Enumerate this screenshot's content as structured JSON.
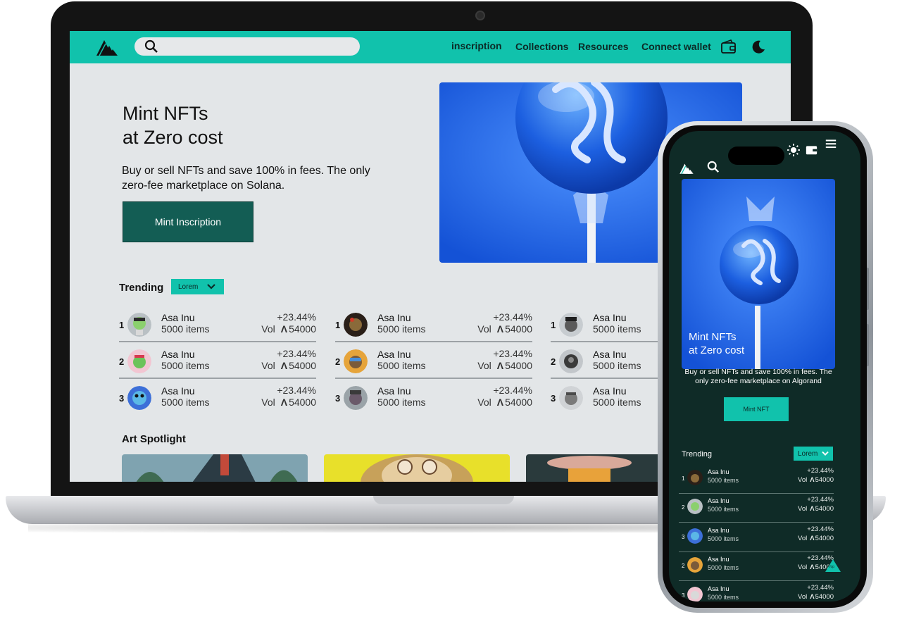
{
  "desktop": {
    "nav": {
      "links": [
        "inscription",
        "Collections",
        "Resources",
        "Connect wallet"
      ],
      "icons": [
        "wallet-icon",
        "moon-icon"
      ]
    },
    "hero": {
      "title_line1": "Mint NFTs",
      "title_line2": "at Zero cost",
      "subtitle": "Buy or sell NFTs and save 100% in fees. The only zero-fee marketplace on Solana.",
      "button_label": "Mint Inscription"
    },
    "trending": {
      "heading": "Trending",
      "dropdown_value": "Lorem",
      "columns": [
        [
          {
            "rank": "1",
            "name": "Asa Inu",
            "items": "5000 items",
            "change": "+23.44%",
            "vol_label": "Vol",
            "volume": "54000"
          },
          {
            "rank": "2",
            "name": "Asa Inu",
            "items": "5000 items",
            "change": "+23.44%",
            "vol_label": "Vol",
            "volume": "54000"
          },
          {
            "rank": "3",
            "name": "Asa Inu",
            "items": "5000 items",
            "change": "+23.44%",
            "vol_label": "Vol",
            "volume": "54000"
          }
        ],
        [
          {
            "rank": "1",
            "name": "Asa Inu",
            "items": "5000 items",
            "change": "+23.44%",
            "vol_label": "Vol",
            "volume": "54000"
          },
          {
            "rank": "2",
            "name": "Asa Inu",
            "items": "5000 items",
            "change": "+23.44%",
            "vol_label": "Vol",
            "volume": "54000"
          },
          {
            "rank": "3",
            "name": "Asa Inu",
            "items": "5000 items",
            "change": "+23.44%",
            "vol_label": "Vol",
            "volume": "54000"
          }
        ],
        [
          {
            "rank": "1",
            "name": "Asa Inu",
            "items": "5000 items"
          },
          {
            "rank": "2",
            "name": "Asa Inu",
            "items": "5000 items"
          },
          {
            "rank": "3",
            "name": "Asa Inu",
            "items": "5000 items"
          }
        ]
      ]
    },
    "art_spotlight": {
      "heading": "Art Spotlight"
    }
  },
  "mobile": {
    "icons": [
      "logo",
      "search-icon",
      "sun-icon",
      "wallet-icon",
      "menu-icon"
    ],
    "hero": {
      "title_line1": "Mint NFTs",
      "title_line2": "at Zero cost",
      "subtitle": "Buy or sell NFTs and save 100% in fees. The only zero-fee marketplace on Algorand",
      "button_label": "Mint  NFT"
    },
    "trending": {
      "heading": "Trending",
      "dropdown_value": "Lorem",
      "rows": [
        {
          "rank": "1",
          "name": "Asa Inu",
          "items": "5000 items",
          "change": "+23.44%",
          "vol_label": "Vol",
          "volume": "54000"
        },
        {
          "rank": "2",
          "name": "Asa Inu",
          "items": "5000 items",
          "change": "+23.44%",
          "vol_label": "Vol",
          "volume": "54000"
        },
        {
          "rank": "3",
          "name": "Asa Inu",
          "items": "5000 items",
          "change": "+23.44%",
          "vol_label": "Vol",
          "volume": "54000"
        },
        {
          "rank": "2",
          "name": "Asa Inu",
          "items": "5000 items",
          "change": "+23.44%",
          "vol_label": "Vol",
          "volume": "54000"
        },
        {
          "rank": "3",
          "name": "Asa Inu",
          "items": "5000 items",
          "change": "+23.44%",
          "vol_label": "Vol",
          "volume": "54000"
        }
      ]
    },
    "scroll_top_label": "Top"
  },
  "colors": {
    "accent": "#11c2ac",
    "dark_green": "#135d54",
    "mobile_bg": "#0f2b27",
    "page_bg": "#e3e6e8"
  }
}
